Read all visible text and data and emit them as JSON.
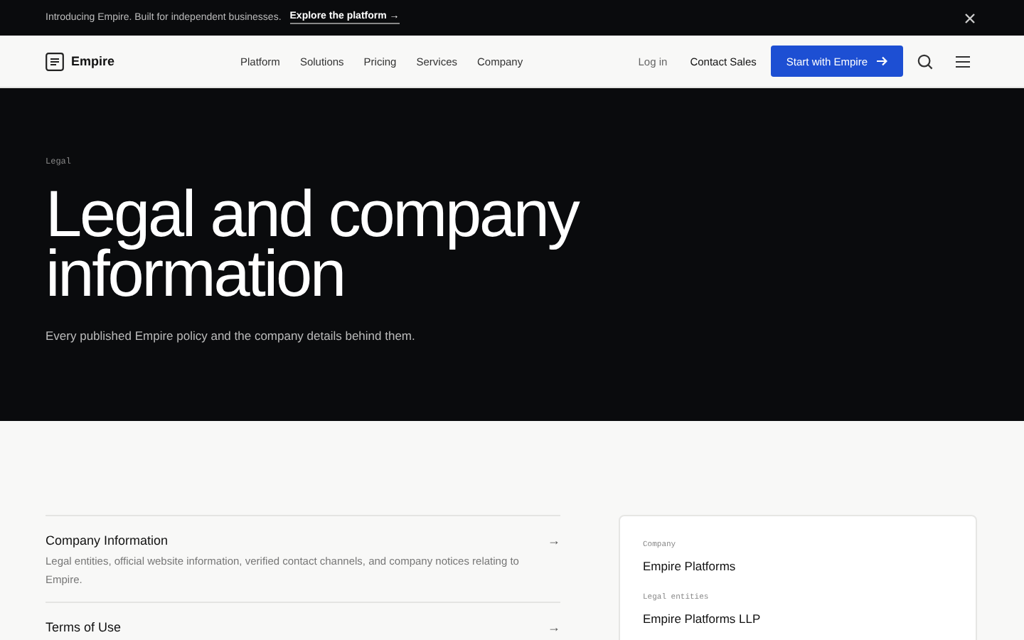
{
  "announcement": {
    "text": "Introducing Empire. Built for independent businesses.",
    "link": "Explore the platform →"
  },
  "nav": {
    "brand": "Empire",
    "links": [
      "Platform",
      "Solutions",
      "Pricing",
      "Services",
      "Company"
    ],
    "login": "Log in",
    "contact": "Contact Sales",
    "cta": "Start with Empire"
  },
  "hero": {
    "eyebrow": "Legal",
    "title": "Legal and company information",
    "subtitle": "Every published Empire policy and the company details behind them."
  },
  "sections": [
    {
      "title": "Company Information",
      "description": "Legal entities, official website information, verified contact channels, and company notices relating to Empire.",
      "arrow": "→"
    },
    {
      "title": "Terms of Use",
      "arrow": "→"
    }
  ],
  "company_card": [
    {
      "label": "Company",
      "value": "Empire Platforms"
    },
    {
      "label": "Legal entities",
      "value": "Empire Platforms LLP"
    }
  ]
}
